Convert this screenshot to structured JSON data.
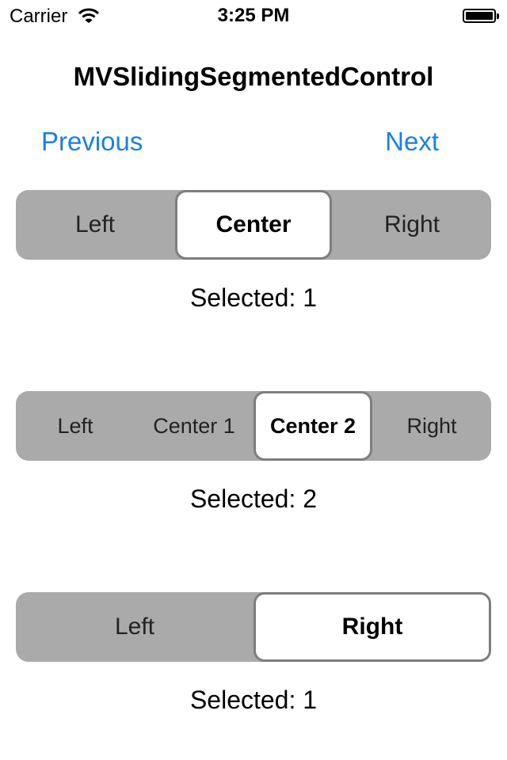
{
  "status_bar": {
    "carrier": "Carrier",
    "time": "3:25 PM"
  },
  "nav": {
    "title": "MVSlidingSegmentedControl",
    "previous": "Previous",
    "next": "Next"
  },
  "controls": [
    {
      "segments": [
        "Left",
        "Center",
        "Right"
      ],
      "selected_index": 1,
      "selected_text": "Selected: 1"
    },
    {
      "segments": [
        "Left",
        "Center 1",
        "Center 2",
        "Right"
      ],
      "selected_index": 2,
      "selected_text": "Selected: 2"
    },
    {
      "segments": [
        "Left",
        "Right"
      ],
      "selected_index": 1,
      "selected_text": "Selected: 1"
    }
  ],
  "colors": {
    "link": "#1a7fe8",
    "track": "#aaaaaa",
    "thumb_border": "#7e7e7e"
  }
}
